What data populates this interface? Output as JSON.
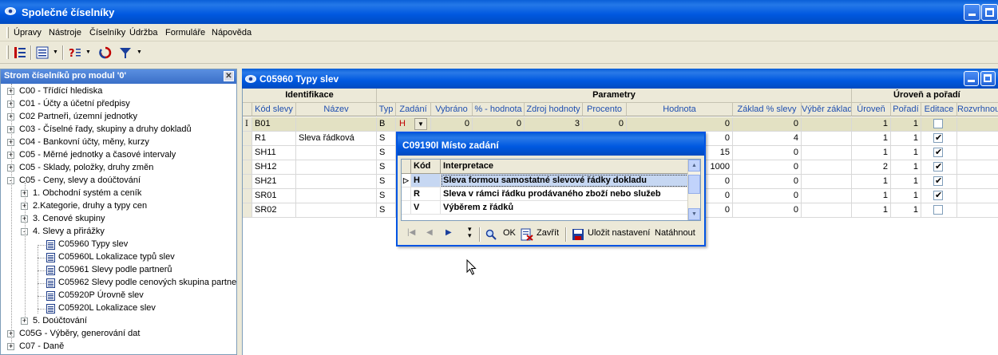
{
  "app": {
    "title": "Společné číselníky"
  },
  "menu": [
    "Úpravy",
    "Nástroje",
    "Číselníky",
    "Údržba",
    "Formuláře",
    "Nápověda"
  ],
  "toolbar": {
    "icons": [
      "tree-icon",
      "list-icon",
      "help-query-icon",
      "refresh-icon",
      "filter-icon"
    ]
  },
  "tree": {
    "header": "Strom číselníků pro modul '0'",
    "items": [
      {
        "label": "C00 - Třídící hlediska",
        "level": 0,
        "expander": "+"
      },
      {
        "label": "C01 - Účty a účetní předpisy",
        "level": 0,
        "expander": "+"
      },
      {
        "label": "C02 Partneři, územní jednotky",
        "level": 0,
        "expander": "+"
      },
      {
        "label": "C03 - Číselné řady, skupiny a druhy dokladů",
        "level": 0,
        "expander": "+"
      },
      {
        "label": "C04 - Bankovní účty, měny, kurzy",
        "level": 0,
        "expander": "+"
      },
      {
        "label": "C05 - Měrné jednotky a časové intervaly",
        "level": 0,
        "expander": "+"
      },
      {
        "label": "C05 - Sklady, položky, druhy změn",
        "level": 0,
        "expander": "+"
      },
      {
        "label": "C05 - Ceny, slevy a doúčtování",
        "level": 0,
        "expander": "-"
      },
      {
        "label": "1. Obchodní systém a ceník",
        "level": 1,
        "expander": "+"
      },
      {
        "label": "2.Kategorie, druhy a typy cen",
        "level": 1,
        "expander": "+"
      },
      {
        "label": "3. Cenové skupiny",
        "level": 1,
        "expander": "+"
      },
      {
        "label": "4. Slevy a přirážky",
        "level": 1,
        "expander": "-"
      },
      {
        "label": "C05960 Typy slev",
        "level": 2,
        "expander": ""
      },
      {
        "label": "C05960L Lokalizace typů slev",
        "level": 2,
        "expander": ""
      },
      {
        "label": "C05961 Slevy podle partnerů",
        "level": 2,
        "expander": ""
      },
      {
        "label": "C05962 Slevy podle cenových skupina partne",
        "level": 2,
        "expander": ""
      },
      {
        "label": "C05920P Úrovně slev",
        "level": 2,
        "expander": ""
      },
      {
        "label": "C05920L Lokalizace slev",
        "level": 2,
        "expander": ""
      },
      {
        "label": "5. Doúčtování",
        "level": 1,
        "expander": "+"
      },
      {
        "label": "C05G - Výběry, generování dat",
        "level": 0,
        "expander": "+"
      },
      {
        "label": "C07 - Daně",
        "level": 0,
        "expander": "+"
      }
    ]
  },
  "doc": {
    "title": "C05960 Typy slev",
    "groups": [
      {
        "label": "Identifikace"
      },
      {
        "label": "Parametry"
      },
      {
        "label": "Úroveň a pořadí"
      }
    ],
    "columns": [
      "Kód slevy",
      "Název",
      "Typ",
      "Zadání",
      "Vybráno",
      "% - hodnota",
      "Zdroj hodnoty",
      "Procento",
      "Hodnota",
      "Základ % slevy",
      "Výběr základů",
      "Úroveň",
      "Pořadí",
      "Editace",
      "Rozvrhnout"
    ],
    "rows": [
      {
        "kod": "B01",
        "nazev": "",
        "typ": "B",
        "zadani": "H",
        "vybrano": "0",
        "phodnota": "0",
        "zdroj": "3",
        "procento": "0",
        "hodnota": "0",
        "zaklad": "0",
        "vyber": "",
        "uroven": "1",
        "poradi": "1",
        "editace": false
      },
      {
        "kod": "R1",
        "nazev": "Sleva řádková",
        "typ": "S",
        "zadani": "",
        "vybrano": "",
        "phodnota": "",
        "zdroj": "",
        "procento": "",
        "hodnota": "0",
        "zaklad": "4",
        "vyber": "",
        "uroven": "1",
        "poradi": "1",
        "editace": true
      },
      {
        "kod": "SH11",
        "nazev": "",
        "typ": "S",
        "zadani": "",
        "vybrano": "",
        "phodnota": "",
        "zdroj": "",
        "procento": "",
        "hodnota": "15",
        "zaklad": "0",
        "vyber": "",
        "uroven": "1",
        "poradi": "1",
        "editace": true
      },
      {
        "kod": "SH12",
        "nazev": "",
        "typ": "S",
        "zadani": "",
        "vybrano": "",
        "phodnota": "",
        "zdroj": "",
        "procento": "",
        "hodnota": "1000",
        "zaklad": "0",
        "vyber": "",
        "uroven": "2",
        "poradi": "1",
        "editace": true
      },
      {
        "kod": "SH21",
        "nazev": "",
        "typ": "S",
        "zadani": "",
        "vybrano": "",
        "phodnota": "",
        "zdroj": "",
        "procento": "",
        "hodnota": "0",
        "zaklad": "0",
        "vyber": "",
        "uroven": "1",
        "poradi": "1",
        "editace": true
      },
      {
        "kod": "SR01",
        "nazev": "",
        "typ": "S",
        "zadani": "",
        "vybrano": "",
        "phodnota": "",
        "zdroj": "",
        "procento": "",
        "hodnota": "0",
        "zaklad": "0",
        "vyber": "",
        "uroven": "1",
        "poradi": "1",
        "editace": true
      },
      {
        "kod": "SR02",
        "nazev": "",
        "typ": "S",
        "zadani": "",
        "vybrano": "",
        "phodnota": "",
        "zdroj": "",
        "procento": "",
        "hodnota": "0",
        "zaklad": "0",
        "vyber": "",
        "uroven": "1",
        "poradi": "1",
        "editace": false
      }
    ]
  },
  "popup": {
    "title": "C09190I Místo zadání",
    "headers": [
      "Kód",
      "Interpretace"
    ],
    "rows": [
      {
        "kod": "H",
        "text": "Sleva formou samostatné slevové řádky dokladu",
        "selected": true
      },
      {
        "kod": "R",
        "text": "Sleva v rámci řádku prodávaného zboží nebo služeb",
        "selected": false
      },
      {
        "kod": "V",
        "text": "Výběrem z řádků",
        "selected": false
      }
    ],
    "buttons": {
      "ok": "OK",
      "close": "Zavřít",
      "save": "Uložit nastavení",
      "pull": "Natáhnout"
    }
  },
  "colors": {
    "titlebar": "#0058e0",
    "selected_row": "#e3e1c3",
    "popup_selected": "#c6d7f2"
  }
}
